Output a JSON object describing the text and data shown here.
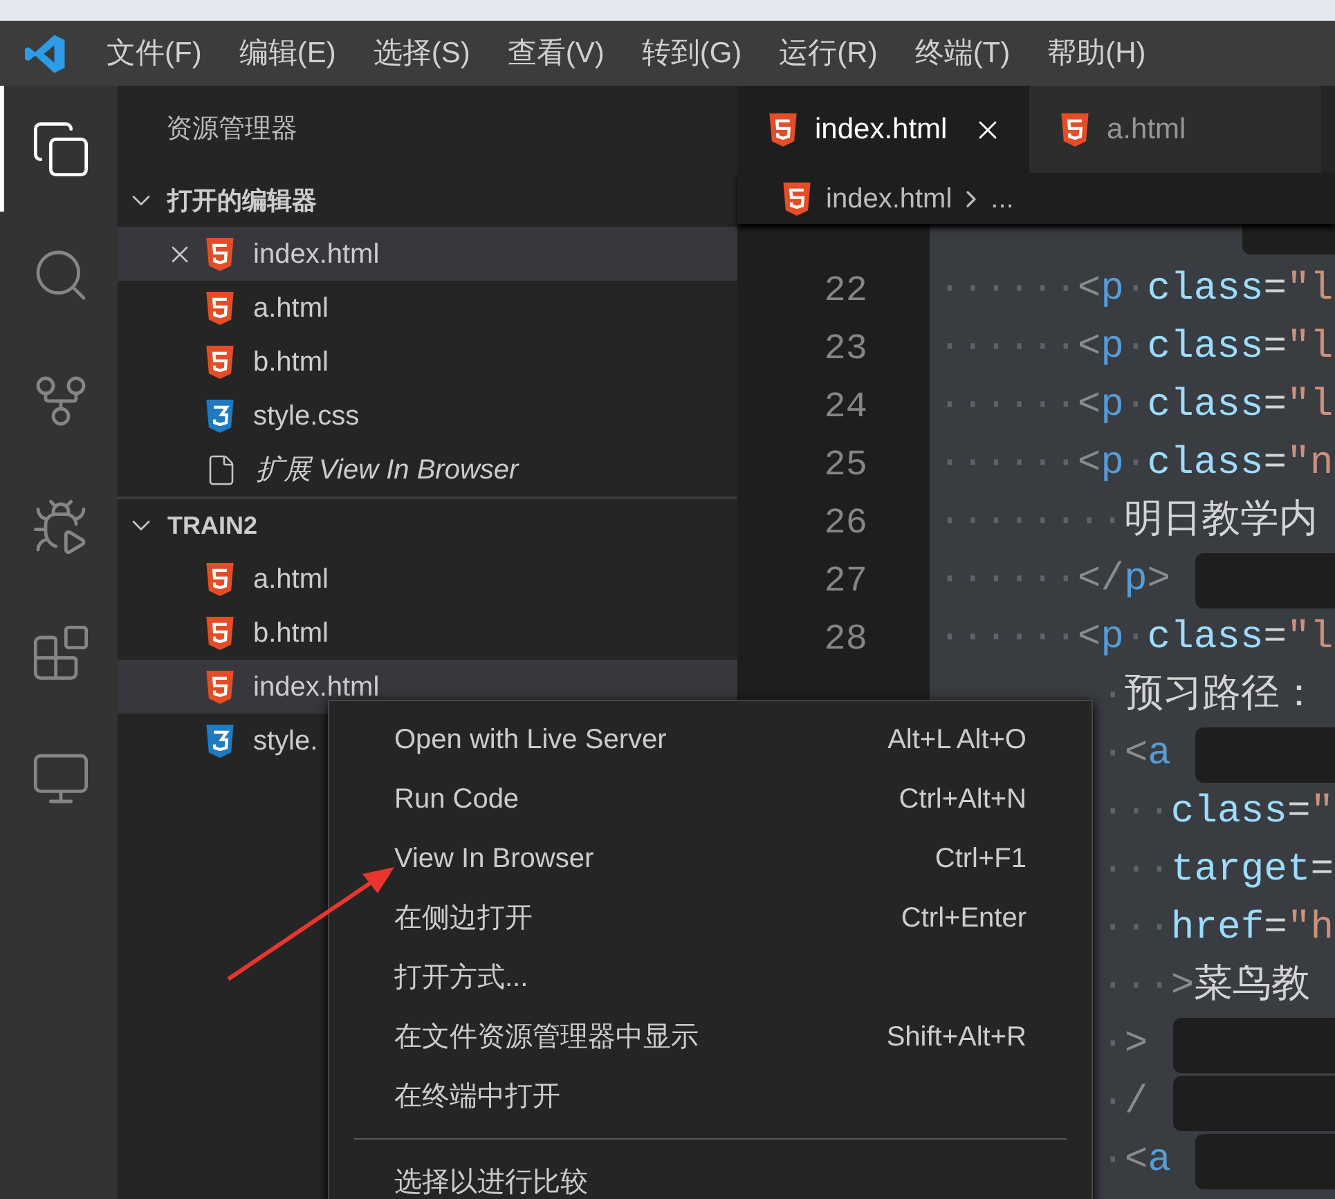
{
  "menu_bar": [
    "文件(F)",
    "编辑(E)",
    "选择(S)",
    "查看(V)",
    "转到(G)",
    "运行(R)",
    "终端(T)",
    "帮助(H)"
  ],
  "activity_bar": [
    {
      "kind": "files",
      "selected": true
    },
    {
      "kind": "search",
      "selected": false
    },
    {
      "kind": "source-control",
      "selected": false
    },
    {
      "kind": "run",
      "selected": false
    },
    {
      "kind": "extensions",
      "selected": false
    },
    {
      "kind": "remote",
      "selected": false
    }
  ],
  "sidebar": {
    "title": "资源管理器",
    "sections": [
      {
        "title": "打开的编辑器",
        "items": [
          {
            "name": "index.html",
            "kind": "html",
            "selected": true
          },
          {
            "name": "a.html",
            "kind": "html",
            "selected": false
          },
          {
            "name": "b.html",
            "kind": "html",
            "selected": false
          },
          {
            "name": "style.css",
            "kind": "css",
            "selected": false
          },
          {
            "name": "扩展 View In Browser",
            "kind": "preview",
            "selected": false
          }
        ]
      },
      {
        "title": "TRAIN2",
        "items": [
          {
            "name": "a.html",
            "kind": "html",
            "selected": false
          },
          {
            "name": "b.html",
            "kind": "html",
            "selected": false
          },
          {
            "name": "index.html",
            "kind": "html",
            "selected": true
          },
          {
            "name": "style.",
            "kind": "css",
            "selected": false
          }
        ]
      }
    ]
  },
  "tabs": [
    {
      "label": "index.html",
      "selected": true
    },
    {
      "label": "a.html",
      "selected": false
    }
  ],
  "breadcrumb": {
    "file": "index.html",
    "more": "..."
  },
  "code_lines": [
    {
      "kind": "cut",
      "masked": true
    },
    {
      "number": "22",
      "kind": "full",
      "masked": false,
      "tokens": [
        {
          "t": "······",
          "kind": "ws"
        },
        {
          "t": "<",
          "kind": "punct"
        },
        {
          "t": "p",
          "kind": "tag"
        },
        {
          "t": "·",
          "kind": "ws"
        },
        {
          "t": "class",
          "kind": "attr"
        },
        {
          "t": "=",
          "kind": "op"
        },
        {
          "t": "\"l",
          "kind": "string"
        }
      ]
    },
    {
      "number": "23",
      "kind": "full",
      "masked": false,
      "tokens": [
        {
          "t": "······",
          "kind": "ws"
        },
        {
          "t": "<",
          "kind": "punct"
        },
        {
          "t": "p",
          "kind": "tag"
        },
        {
          "t": "·",
          "kind": "ws"
        },
        {
          "t": "class",
          "kind": "attr"
        },
        {
          "t": "=",
          "kind": "op"
        },
        {
          "t": "\"l",
          "kind": "string"
        }
      ]
    },
    {
      "number": "24",
      "kind": "full",
      "masked": false,
      "tokens": [
        {
          "t": "······",
          "kind": "ws"
        },
        {
          "t": "<",
          "kind": "punct"
        },
        {
          "t": "p",
          "kind": "tag"
        },
        {
          "t": "·",
          "kind": "ws"
        },
        {
          "t": "class",
          "kind": "attr"
        },
        {
          "t": "=",
          "kind": "op"
        },
        {
          "t": "\"l",
          "kind": "string"
        }
      ]
    },
    {
      "number": "25",
      "kind": "full",
      "masked": false,
      "tokens": [
        {
          "t": "······",
          "kind": "ws"
        },
        {
          "t": "<",
          "kind": "punct"
        },
        {
          "t": "p",
          "kind": "tag"
        },
        {
          "t": "·",
          "kind": "ws"
        },
        {
          "t": "class",
          "kind": "attr"
        },
        {
          "t": "=",
          "kind": "op"
        },
        {
          "t": "\"n",
          "kind": "string"
        }
      ]
    },
    {
      "number": "26",
      "kind": "full",
      "masked": false,
      "tokens": [
        {
          "t": "········",
          "kind": "ws"
        },
        {
          "t": "明日教学内",
          "kind": "text"
        }
      ]
    },
    {
      "number": "27",
      "kind": "full",
      "masked": true,
      "tokens": [
        {
          "t": "······",
          "kind": "ws"
        },
        {
          "t": "</",
          "kind": "punct"
        },
        {
          "t": "p",
          "kind": "tag"
        },
        {
          "t": ">",
          "kind": "punct"
        }
      ]
    },
    {
      "number": "28",
      "kind": "full",
      "masked": false,
      "tokens": [
        {
          "t": "······",
          "kind": "ws"
        },
        {
          "t": "<",
          "kind": "punct"
        },
        {
          "t": "p",
          "kind": "tag"
        },
        {
          "t": "·",
          "kind": "ws"
        },
        {
          "t": "class",
          "kind": "attr"
        },
        {
          "t": "=",
          "kind": "op"
        },
        {
          "t": "\"l",
          "kind": "string"
        }
      ]
    },
    {
      "kind": "partial",
      "masked": false,
      "tokens": [
        {
          "t": "·",
          "kind": "ws"
        },
        {
          "t": "预习路径：",
          "kind": "text"
        }
      ]
    },
    {
      "kind": "partial",
      "masked": true,
      "tokens": [
        {
          "t": "·",
          "kind": "ws"
        },
        {
          "t": "<",
          "kind": "punct"
        },
        {
          "t": "a",
          "kind": "tag"
        }
      ]
    },
    {
      "kind": "partial",
      "masked": false,
      "tokens": [
        {
          "t": "···",
          "kind": "ws"
        },
        {
          "t": "class",
          "kind": "attr"
        },
        {
          "t": "=",
          "kind": "op"
        },
        {
          "t": "\"",
          "kind": "string"
        }
      ]
    },
    {
      "kind": "partial",
      "masked": false,
      "tokens": [
        {
          "t": "···",
          "kind": "ws"
        },
        {
          "t": "target",
          "kind": "attr"
        },
        {
          "t": "=",
          "kind": "op"
        }
      ]
    },
    {
      "kind": "partial",
      "masked": false,
      "tokens": [
        {
          "t": "···",
          "kind": "ws"
        },
        {
          "t": "href",
          "kind": "attr"
        },
        {
          "t": "=",
          "kind": "op"
        },
        {
          "t": "\"h",
          "kind": "string"
        }
      ]
    },
    {
      "kind": "partial",
      "masked": false,
      "tokens": [
        {
          "t": "···",
          "kind": "ws"
        },
        {
          "t": ">",
          "kind": "punct"
        },
        {
          "t": "菜鸟教",
          "kind": "text"
        }
      ]
    },
    {
      "kind": "partial",
      "masked": true,
      "tokens": [
        {
          "t": "·",
          "kind": "ws"
        },
        {
          "t": ">",
          "kind": "punct"
        }
      ]
    },
    {
      "kind": "partial",
      "masked": true,
      "tokens": [
        {
          "t": "·",
          "kind": "ws"
        },
        {
          "t": "/",
          "kind": "punct"
        }
      ]
    },
    {
      "kind": "partial",
      "masked": true,
      "tokens": [
        {
          "t": "·",
          "kind": "ws"
        },
        {
          "t": "<",
          "kind": "punct"
        },
        {
          "t": "a",
          "kind": "tag"
        }
      ]
    }
  ],
  "context_menu": [
    {
      "kind": "item",
      "label": "Open with Live Server",
      "shortcut": "Alt+L Alt+O"
    },
    {
      "kind": "item",
      "label": "Run Code",
      "shortcut": "Ctrl+Alt+N"
    },
    {
      "kind": "item",
      "label": "View In Browser",
      "shortcut": "Ctrl+F1"
    },
    {
      "kind": "item",
      "label": "在侧边打开",
      "shortcut": "Ctrl+Enter"
    },
    {
      "kind": "item",
      "label": "打开方式..."
    },
    {
      "kind": "item",
      "label": "在文件资源管理器中显示",
      "shortcut": "Shift+Alt+R"
    },
    {
      "kind": "item",
      "label": "在终端中打开"
    },
    {
      "kind": "separator"
    },
    {
      "kind": "item",
      "label": "选择以进行比较"
    }
  ]
}
